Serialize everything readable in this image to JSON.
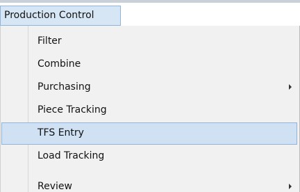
{
  "menubar": {
    "title": "Production Control"
  },
  "menu": {
    "items": [
      {
        "label": "Filter"
      },
      {
        "label": "Combine"
      },
      {
        "label": "Purchasing",
        "has_submenu": true
      },
      {
        "label": "Piece Tracking"
      },
      {
        "label": "TFS Entry",
        "selected": true
      },
      {
        "label": "Load Tracking"
      },
      {
        "label": "Review",
        "has_submenu": true
      }
    ]
  },
  "colors": {
    "highlight": "#cfe1f3",
    "highlight_border": "#8fb3d9",
    "menu_background": "#f1f1f1"
  }
}
